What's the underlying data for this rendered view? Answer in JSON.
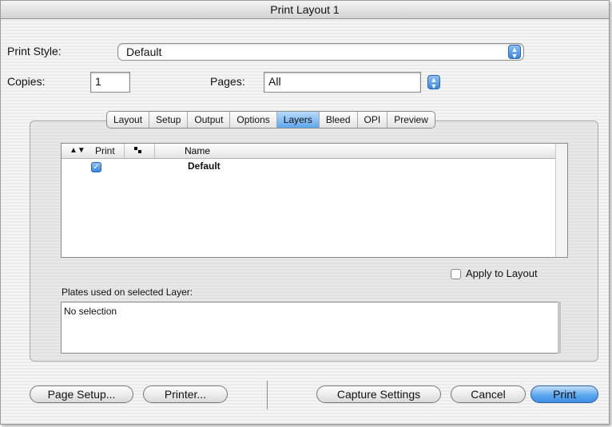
{
  "window": {
    "title": "Print Layout 1"
  },
  "print_style": {
    "label": "Print Style:",
    "value": "Default"
  },
  "copies": {
    "label": "Copies:",
    "value": "1"
  },
  "pages": {
    "label": "Pages:",
    "value": "All"
  },
  "tabs": [
    {
      "label": "Layout",
      "active": false
    },
    {
      "label": "Setup",
      "active": false
    },
    {
      "label": "Output",
      "active": false
    },
    {
      "label": "Options",
      "active": false
    },
    {
      "label": "Layers",
      "active": true
    },
    {
      "label": "Bleed",
      "active": false
    },
    {
      "label": "OPI",
      "active": false
    },
    {
      "label": "Preview",
      "active": false
    }
  ],
  "layers_table": {
    "columns": {
      "print": "Print",
      "name": "Name"
    },
    "rows": [
      {
        "print_checked": true,
        "name": "Default"
      }
    ]
  },
  "apply_to_layout": {
    "label": "Apply to Layout",
    "checked": false
  },
  "plates": {
    "label": "Plates used on selected Layer:",
    "value": "No selection"
  },
  "buttons": {
    "page_setup": "Page Setup...",
    "printer": "Printer...",
    "capture_settings": "Capture Settings",
    "cancel": "Cancel",
    "print": "Print"
  },
  "colors": {
    "accent": "#5ea7ee",
    "accent_dark": "#3167a9"
  }
}
